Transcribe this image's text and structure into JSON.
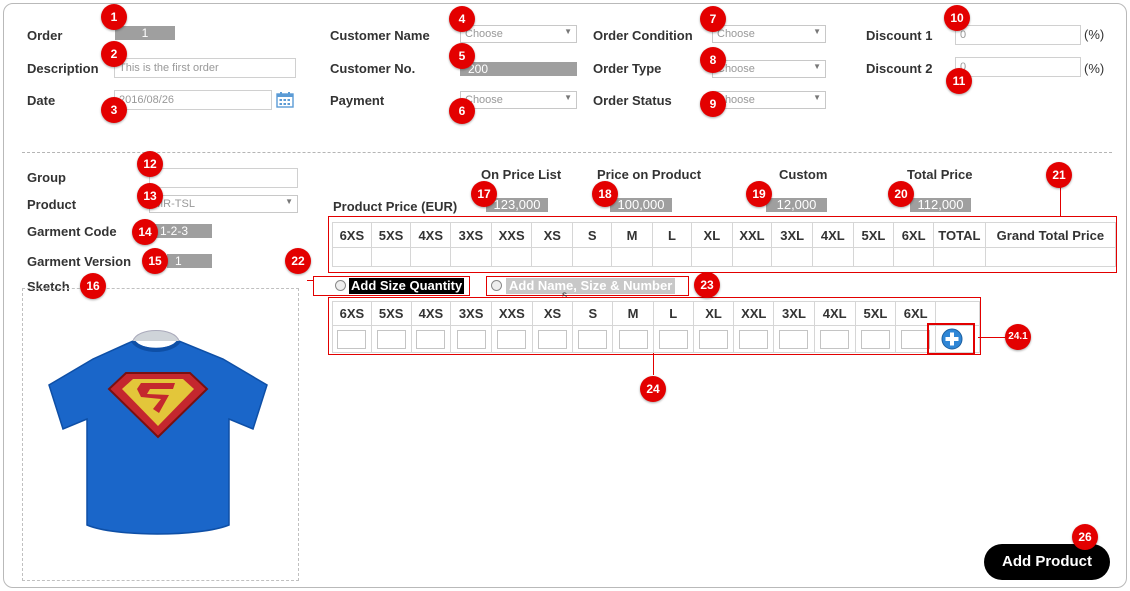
{
  "badges": [
    "1",
    "2",
    "3",
    "4",
    "5",
    "6",
    "7",
    "8",
    "9",
    "10",
    "11",
    "12",
    "13",
    "14",
    "15",
    "16",
    "17",
    "18",
    "19",
    "20",
    "21",
    "22",
    "23",
    "24",
    "24.1",
    "26"
  ],
  "order": {
    "order_label": "Order",
    "order_value": "1",
    "description_label": "Description",
    "description_placeholder": "This is the first order",
    "date_label": "Date",
    "date_value": "2016/08/26",
    "customer_name_label": "Customer Name",
    "customer_name_value": "Choose",
    "customer_no_label": "Customer No.",
    "customer_no_value": "200",
    "payment_label": "Payment",
    "payment_value": "Choose",
    "order_condition_label": "Order Condition",
    "order_condition_value": "Choose",
    "order_type_label": "Order Type",
    "order_type_value": "Choose",
    "order_status_label": "Order Status",
    "order_status_value": "Choose",
    "discount1_label": "Discount 1",
    "discount1_value": "0",
    "discount2_label": "Discount 2",
    "discount2_value": "0",
    "percent_unit": "(%)"
  },
  "product": {
    "group_label": "Group",
    "group_value": "",
    "product_label": "Product",
    "product_value": "MR-TSL",
    "garment_code_label": "Garment Code",
    "garment_code_value": "1-2-3",
    "garment_version_label": "Garment Version",
    "garment_version_value": "1",
    "sketch_label": "Sketch"
  },
  "pricing": {
    "product_price_label": "Product Price (EUR)",
    "on_price_list_label": "On Price List",
    "on_price_list_value": "123,000",
    "price_on_product_label": "Price on Product",
    "price_on_product_value": "100,000",
    "custom_label": "Custom",
    "custom_value": "12,000",
    "total_price_label": "Total Price",
    "total_price_value": "112,000"
  },
  "size_headers": [
    "6XS",
    "5XS",
    "4XS",
    "3XS",
    "XXS",
    "XS",
    "S",
    "M",
    "L",
    "XL",
    "XXL",
    "3XL",
    "4XL",
    "5XL",
    "6XL"
  ],
  "summary_extra_headers": [
    "TOTAL",
    "Grand Total Price"
  ],
  "options": {
    "add_size_quantity_label": "Add Size Quantity",
    "add_name_size_number_label": "Add Name, Size & Number",
    "stray_mark": "s"
  },
  "actions": {
    "add_product_label": "Add Product",
    "add_row_icon": "plus-circle-icon"
  },
  "colors": {
    "badge": "#e30000",
    "readonly_fill": "#9f9f9f",
    "highlight_box": "#e20000",
    "button": "#000000",
    "shirt": "#1a66c9"
  }
}
